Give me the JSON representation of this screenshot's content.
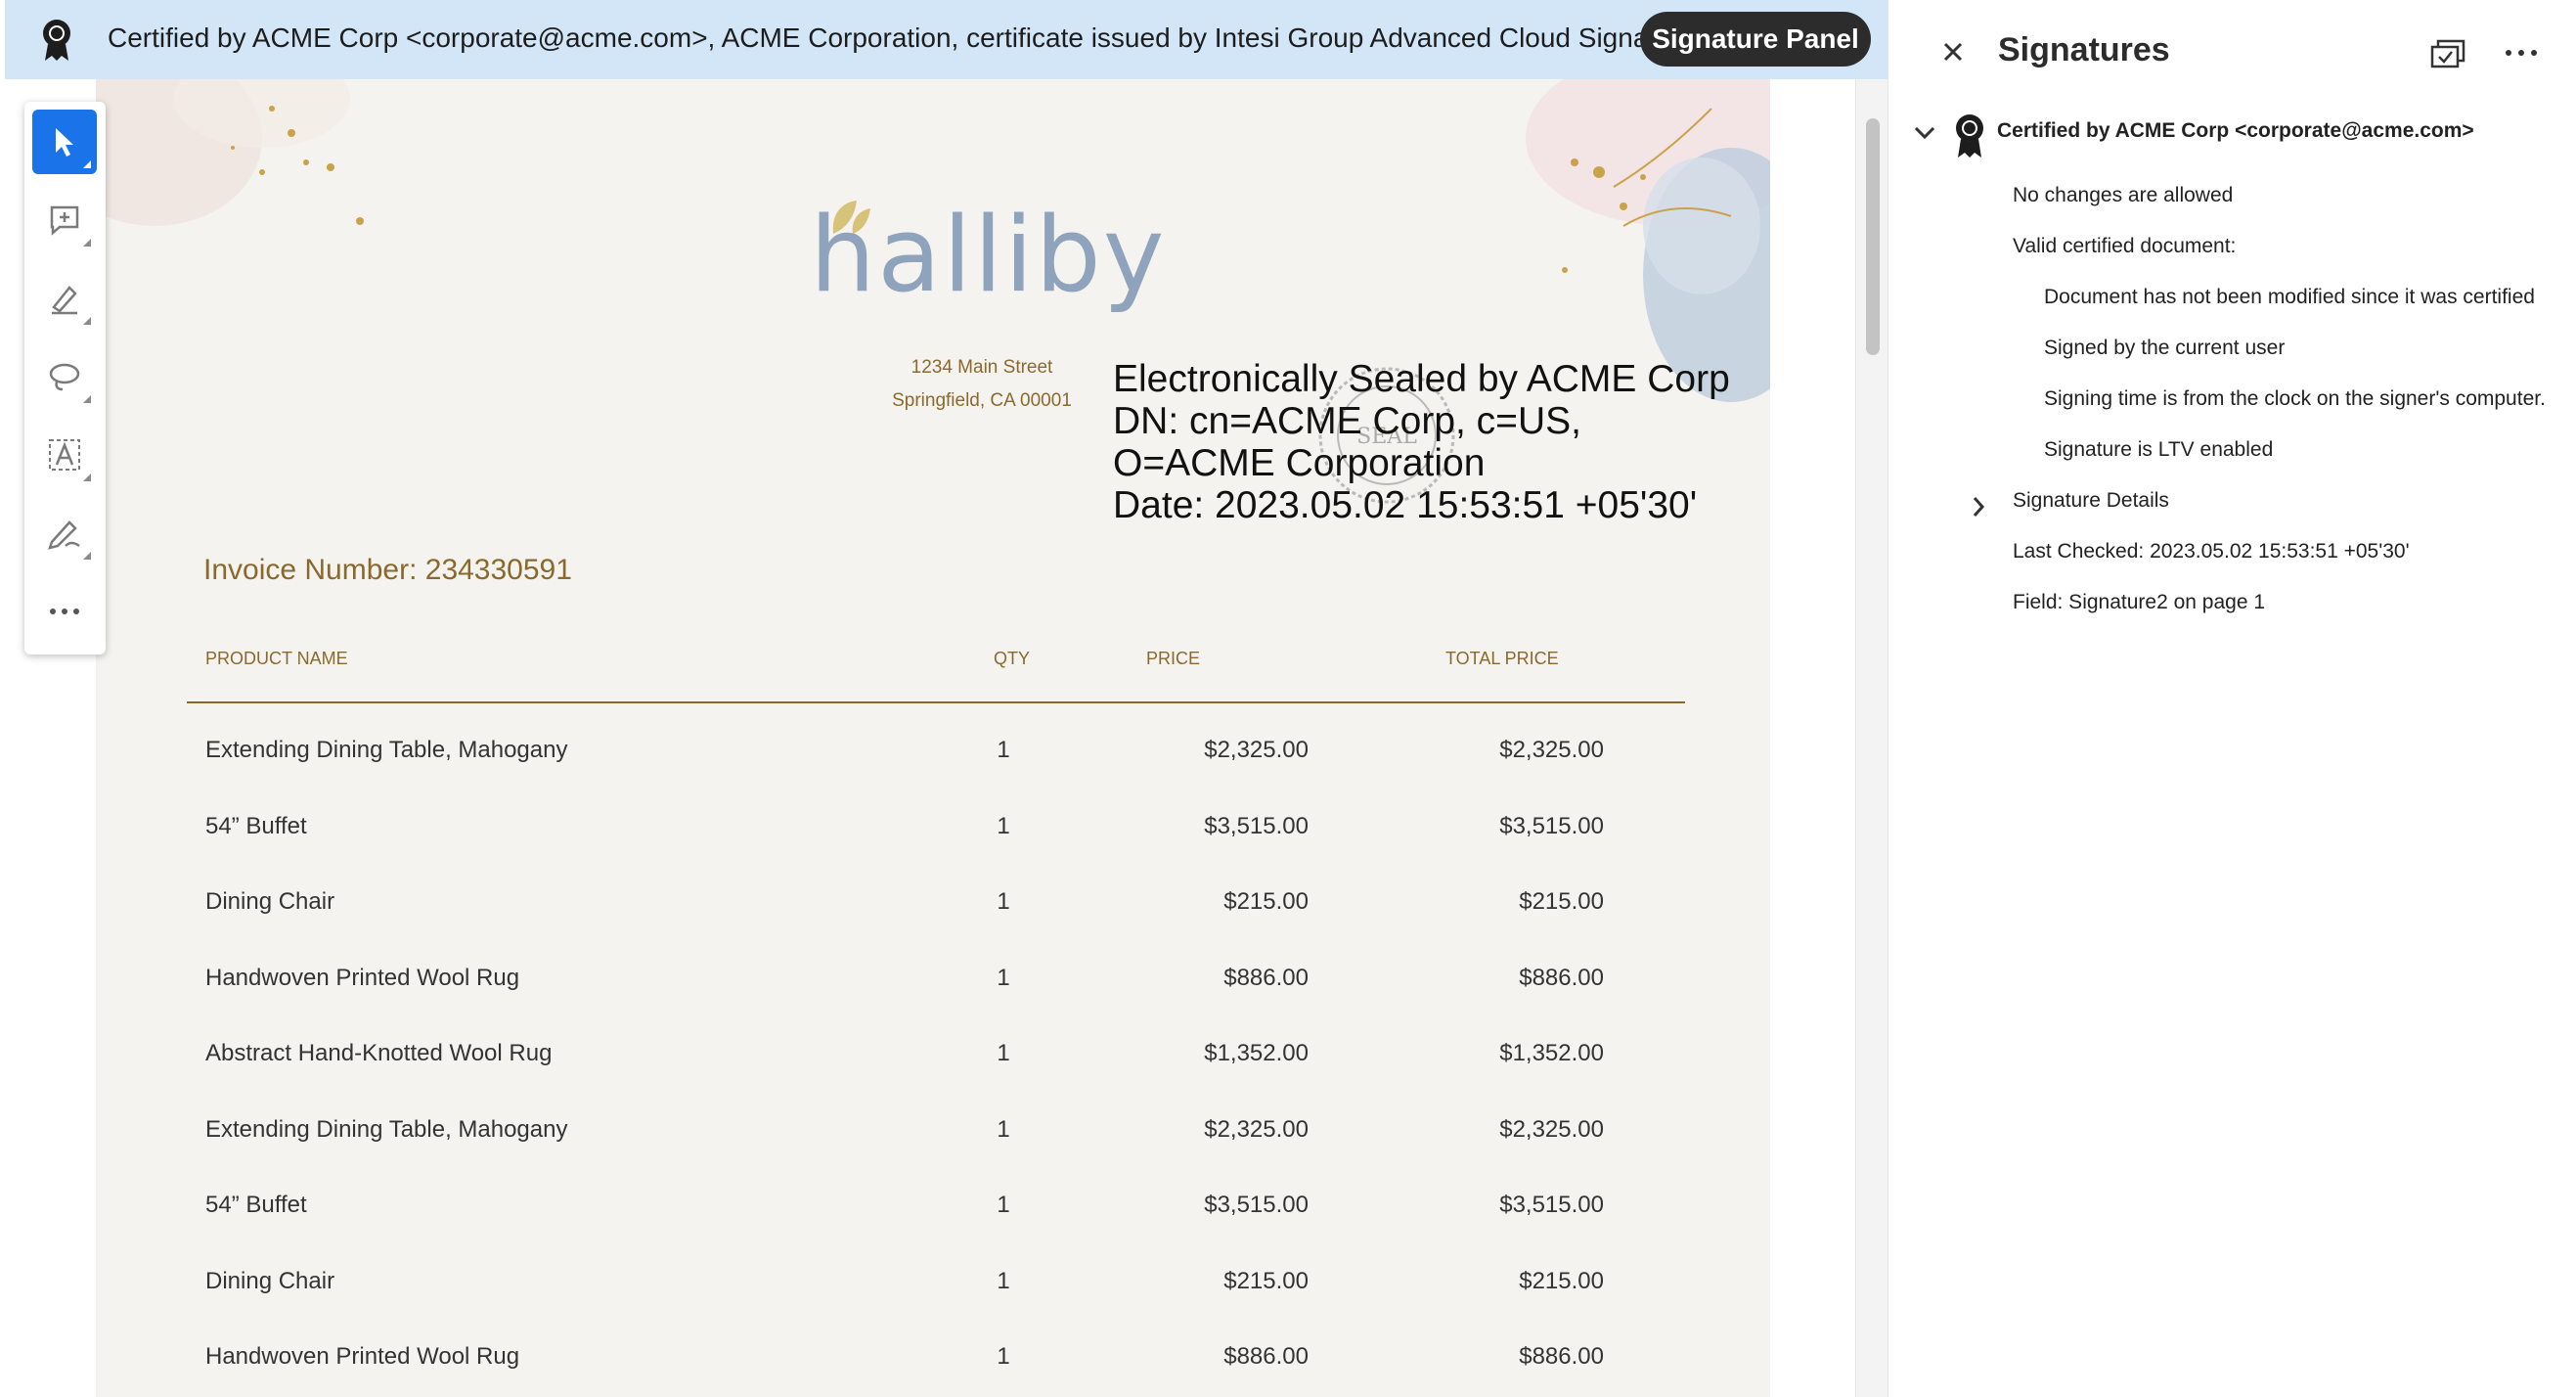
{
  "banner": {
    "text": "Certified by ACME Corp <corporate@acme.com>, ACME Corporation, certificate issued by Intesi Group Advanced Cloud Signature CA",
    "button_label": "Signature Panel"
  },
  "toolbar": {
    "tools": [
      "select-icon",
      "comment-icon",
      "highlight-pen-icon",
      "lasso-icon",
      "text-box-icon",
      "signature-pen-icon",
      "more-icon"
    ]
  },
  "document": {
    "logo": "halliby",
    "address_line1": "1234 Main Street",
    "address_line2": "Springfield, CA 00001",
    "seal_lines": [
      "Electronically Sealed by ACME Corp",
      "DN: cn=ACME Corp, c=US,",
      "O=ACME Corporation",
      "Date: 2023.05.02 15:53:51 +05'30'"
    ],
    "stamp_text": "SEAL",
    "invoice_label": "Invoice Number: 234330591",
    "headers": [
      "PRODUCT NAME",
      "QTY",
      "PRICE",
      "TOTAL PRICE"
    ],
    "rows": [
      [
        "Extending Dining Table, Mahogany",
        "1",
        "$2,325.00",
        "$2,325.00"
      ],
      [
        "54” Buffet",
        "1",
        "$3,515.00",
        "$3,515.00"
      ],
      [
        "Dining Chair",
        "1",
        "$215.00",
        "$215.00"
      ],
      [
        "Handwoven Printed Wool Rug",
        "1",
        "$886.00",
        "$886.00"
      ],
      [
        "Abstract Hand-Knotted Wool Rug",
        "1",
        "$1,352.00",
        "$1,352.00"
      ],
      [
        "Extending Dining Table, Mahogany",
        "1",
        "$2,325.00",
        "$2,325.00"
      ],
      [
        "54” Buffet",
        "1",
        "$3,515.00",
        "$3,515.00"
      ],
      [
        "Dining Chair",
        "1",
        "$215.00",
        "$215.00"
      ],
      [
        "Handwoven Printed Wool Rug",
        "1",
        "$886.00",
        "$886.00"
      ]
    ]
  },
  "panel": {
    "title": "Signatures",
    "cert_title": "Certified by ACME Corp <corporate@acme.com>",
    "lines": [
      "No changes are allowed",
      "Valid certified document:",
      "Document has not been modified since it was certified",
      "Signed by the current user",
      "Signing time is from the clock on the signer's computer.",
      "Signature is LTV enabled",
      "Signature Details",
      "Last Checked: 2023.05.02 15:53:51 +05'30'",
      "Field: Signature2 on page 1"
    ]
  },
  "colors": {
    "banner_bg": "#d2e6f8",
    "accent": "#1a73e8",
    "gold": "#8a6a2c"
  }
}
